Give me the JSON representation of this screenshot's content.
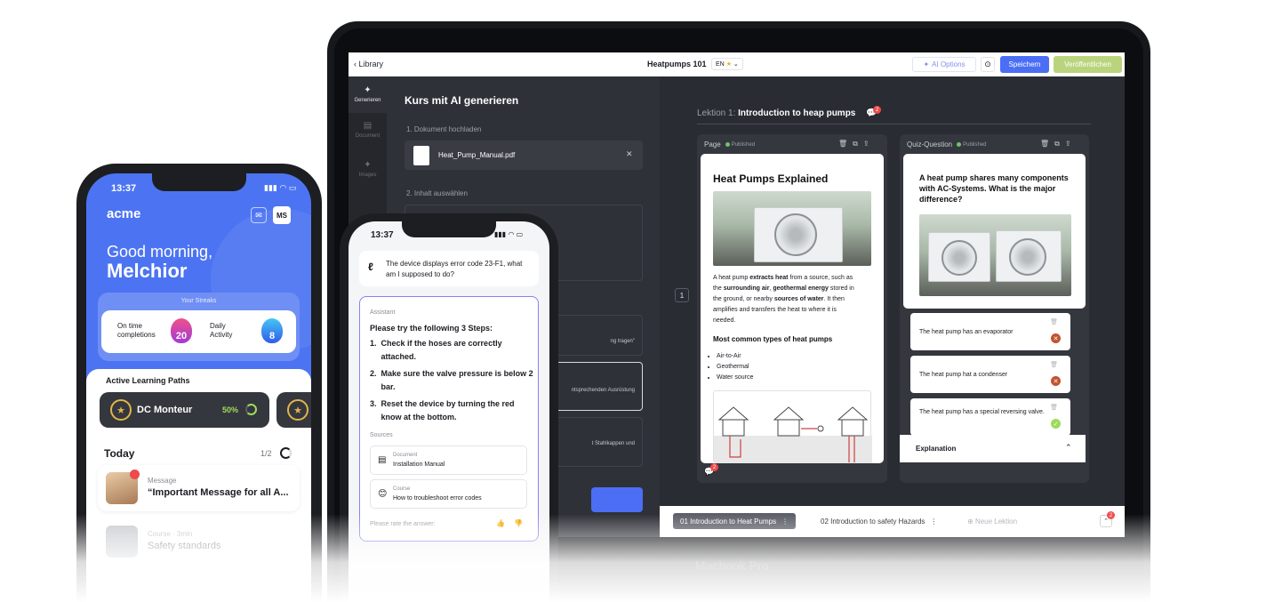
{
  "laptop": {
    "topbar": {
      "back_label": "Library",
      "title": "Heatpumps 101",
      "language": "EN",
      "ai_options": "AI Options",
      "save": "Speichern",
      "publish": "Veröffentlichen"
    },
    "rail": [
      {
        "label": "Generieren",
        "icon": "sparkle-icon"
      },
      {
        "label": "Document",
        "icon": "document-icon"
      },
      {
        "label": "Images",
        "icon": "image-icon"
      }
    ],
    "generate": {
      "title": "Kurs mit AI generieren",
      "step1": "1. Dokument hochladen",
      "file_name": "Heat_Pump_Manual.pdf",
      "step2": "2. Inhalt auswählen",
      "option_b": "ng tragen\"",
      "option_c": "ntsprechenden Ausrüstung",
      "option_d": "t Stahlkappen und"
    },
    "lesson": {
      "prefix": "Lektion 1:",
      "name": "Introduction to heap pumps",
      "comment_count": "2",
      "page_number": "1"
    },
    "page_col": {
      "label": "Page",
      "status": "Published",
      "title": "Heat Pumps Explained",
      "body_parts": [
        {
          "t": "A heat pump ",
          "b": false
        },
        {
          "t": "extracts heat",
          "b": true
        },
        {
          "t": " from a source, such as the ",
          "b": false
        },
        {
          "t": "surrounding air",
          "b": true
        },
        {
          "t": ", ",
          "b": false
        },
        {
          "t": "geothermal energy",
          "b": true
        },
        {
          "t": " stored in the ground, or nearby ",
          "b": false
        },
        {
          "t": "sources of water",
          "b": true
        },
        {
          "t": ". It then amplifies and transfers the heat to where it is needed.",
          "b": false
        }
      ],
      "subheading": "Most common types of heat pumps",
      "types": [
        "Air-to-Air",
        "Geothermal",
        "Water source"
      ],
      "comment_count": "2"
    },
    "quiz_col": {
      "label": "Quiz-Question",
      "status": "Published",
      "question": "A heat pump shares many components with AC-Systems. What is the major difference?",
      "answers": [
        {
          "text": "The heat pump has an evaporator",
          "correct": false
        },
        {
          "text": "The heat pump hat a condenser",
          "correct": false
        },
        {
          "text": "The heat pump has a special reversing valve.",
          "correct": true
        }
      ],
      "explanation": "Explanation"
    },
    "lessonbar": {
      "tabs": [
        {
          "num": "01",
          "label": "Introduction to Heat Pumps",
          "active": true
        },
        {
          "num": "02",
          "label": "Introduction to safety Hazards",
          "active": false
        }
      ],
      "new_lesson": "Neue Lektion",
      "notif_count": "2"
    },
    "model_label": "Macbook Pro"
  },
  "phone_left": {
    "time": "13:37",
    "logo": "acme",
    "avatar_initials": "MS",
    "greeting": "Good morning,",
    "name": "Melchior",
    "streaks": {
      "title": "Your Streaks",
      "on_time_label": "On time completions",
      "on_time_value": "20",
      "daily_label": "Daily Activity",
      "daily_value": "8"
    },
    "learning_paths": {
      "title": "Active Learning Paths",
      "items": [
        {
          "name": "DC Monteur",
          "progress": "50%"
        }
      ]
    },
    "today": {
      "title": "Today",
      "count": "1/2",
      "items": [
        {
          "kind": "Message",
          "text": "“Important Message for all A..."
        },
        {
          "kind": "Course · 3min",
          "text": "Safety standards"
        }
      ]
    }
  },
  "phone_mid": {
    "time": "13:37",
    "question": "The device displays error code 23-F1, what am I supposed to do?",
    "assistant_label": "Assistant",
    "intro": "Please try the following 3 Steps:",
    "steps": [
      "Check if the hoses are correctly attached.",
      "Make sure the valve pressure is below 2 bar.",
      "Reset the device by turning the red know at the bottom."
    ],
    "sources_label": "Sources",
    "sources": [
      {
        "kind": "Document",
        "name": "Installation Manual"
      },
      {
        "kind": "Course",
        "name": "How to troubleshoot error codes"
      }
    ],
    "rate_label": "Please rate the answer:"
  },
  "colors": {
    "accent": "#4b6ef5",
    "publish": "#b9d47c",
    "phone_bg": "#4c74f2",
    "correct": "#9ddc59",
    "wrong": "#c2532f"
  }
}
